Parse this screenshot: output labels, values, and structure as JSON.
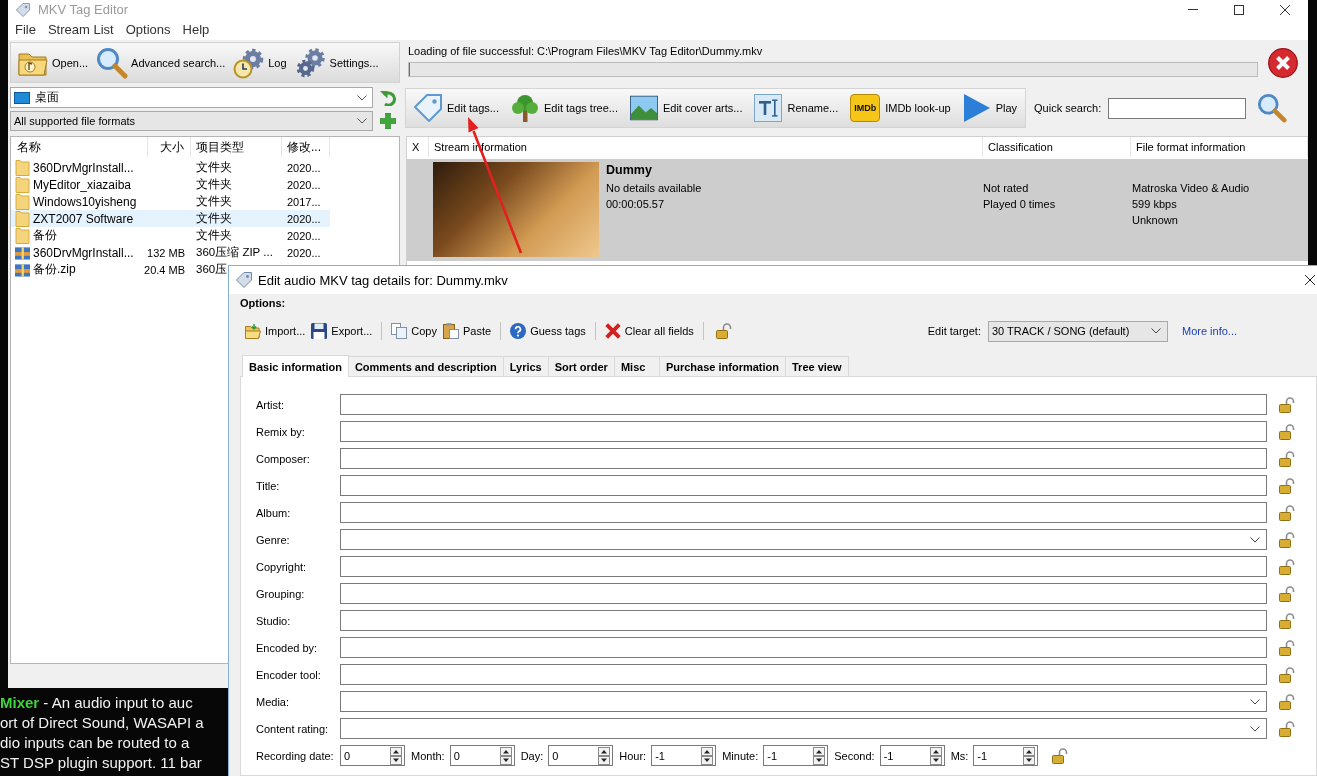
{
  "desktop": {
    "text_lines": [
      "**Mixer** - An audio input to auc",
      "ort of Direct Sound, WASAPI a",
      "dio inputs can be routed to a",
      "ST DSP plugin support. 11 bar"
    ]
  },
  "window": {
    "title": "MKV Tag Editor"
  },
  "menu": [
    "File",
    "Stream List",
    "Options",
    "Help"
  ],
  "browser": {
    "toolbar": [
      {
        "kind": "open",
        "label": "Open..."
      },
      {
        "kind": "search",
        "label": "Advanced search..."
      },
      {
        "kind": "log",
        "label": "Log"
      },
      {
        "kind": "settings",
        "label": "Settings..."
      }
    ],
    "location": "桌面",
    "filter": "All supported file formats",
    "columns": [
      "名称",
      "大小",
      "项目类型",
      "修改..."
    ],
    "rows": [
      {
        "kind": "folder",
        "name": "360DrvMgrInstall...",
        "type": "文件夹",
        "modified": "2020...",
        "selected": false
      },
      {
        "kind": "folder",
        "name": "MyEditor_xiazaiba",
        "type": "文件夹",
        "modified": "2020...",
        "selected": false
      },
      {
        "kind": "folder",
        "name": "Windows10yisheng",
        "type": "文件夹",
        "modified": "2017...",
        "selected": false
      },
      {
        "kind": "folder",
        "name": "ZXT2007 Software",
        "type": "文件夹",
        "modified": "2020...",
        "selected": true
      },
      {
        "kind": "folder",
        "name": "备份",
        "type": "文件夹",
        "modified": "2020...",
        "selected": false
      },
      {
        "kind": "archive",
        "name": "360DrvMgrInstall...",
        "size": "132 MB",
        "type": "360压缩 ZIP ...",
        "modified": "2020...",
        "selected": false
      },
      {
        "kind": "archive",
        "name": "备份.zip",
        "size": "20.4 MB",
        "type": "360压",
        "selected": false
      }
    ]
  },
  "status": {
    "message": "Loading of file successful: C:\\Program Files\\MKV Tag Editor\\Dummy.mkv",
    "progress": {
      "level": 0
    }
  },
  "stream_toolbar": {
    "buttons": [
      {
        "kind": "tag",
        "label": "Edit tags..."
      },
      {
        "kind": "tree",
        "label": "Edit tags tree..."
      },
      {
        "kind": "cover",
        "label": "Edit cover arts..."
      },
      {
        "kind": "rename",
        "label": "Rename..."
      },
      {
        "kind": "imdb",
        "logo": "IMDb",
        "label": "IMDb look-up"
      },
      {
        "kind": "play",
        "label": "Play"
      }
    ],
    "quick_search_label": "Quick search:"
  },
  "stream_table": {
    "columns": [
      "X",
      "Stream information",
      "Classification",
      "File format information"
    ],
    "rows": [
      {
        "selected": true,
        "title": "Dummy",
        "details": [
          "No details available",
          "00:00:05.57"
        ],
        "classification": [
          "Not rated",
          "Played 0 times"
        ],
        "format": [
          "Matroska Video & Audio",
          "599 kbps",
          "Unknown"
        ]
      }
    ]
  },
  "dialog": {
    "title": "Edit audio MKV tag details for: Dummy.mkv",
    "options_label": "Options:",
    "toolbar": [
      {
        "kind": "import",
        "label": "Import..."
      },
      {
        "kind": "export",
        "label": "Export..."
      },
      {
        "kind": "separator"
      },
      {
        "kind": "copy",
        "label": "Copy"
      },
      {
        "kind": "paste",
        "label": "Paste"
      },
      {
        "kind": "separator"
      },
      {
        "kind": "guess",
        "label": "Guess tags"
      },
      {
        "kind": "separator"
      },
      {
        "kind": "clear",
        "label": "Clear all fields"
      },
      {
        "kind": "separator"
      },
      {
        "kind": "lock",
        "locked": false
      }
    ],
    "edit_target": {
      "label": "Edit target:",
      "value": "30 TRACK / SONG (default)"
    },
    "more_info": "More info...",
    "tabs": [
      {
        "label": "Basic information",
        "selected": true
      },
      {
        "label": "Comments and description",
        "selected": false
      },
      {
        "label": "Lyrics",
        "selected": false
      },
      {
        "label": "Sort order",
        "selected": false
      },
      {
        "label": "Misc",
        "selected": false
      },
      {
        "label": "Purchase information",
        "selected": false
      },
      {
        "label": "Tree view",
        "selected": false
      }
    ],
    "fields": [
      {
        "kind": "text",
        "label": "Artist:",
        "locked": false
      },
      {
        "kind": "text",
        "label": "Remix by:",
        "locked": false
      },
      {
        "kind": "text",
        "label": "Composer:",
        "locked": false
      },
      {
        "kind": "text",
        "label": "Title:",
        "locked": false
      },
      {
        "kind": "text",
        "label": "Album:",
        "locked": false
      },
      {
        "kind": "dropdown",
        "label": "Genre:",
        "locked": false
      },
      {
        "kind": "text",
        "label": "Copyright:",
        "locked": false
      },
      {
        "kind": "text",
        "label": "Grouping:",
        "locked": false
      },
      {
        "kind": "text",
        "label": "Studio:",
        "locked": false
      },
      {
        "kind": "text",
        "label": "Encoded by:",
        "locked": false
      },
      {
        "kind": "text",
        "label": "Encoder tool:",
        "locked": false
      },
      {
        "kind": "dropdown",
        "label": "Media:",
        "locked": false
      },
      {
        "kind": "dropdown",
        "label": "Content rating:",
        "locked": false
      }
    ],
    "date_row": {
      "label": "Recording date:",
      "locked": false,
      "spinners": [
        {
          "value": "0"
        },
        {
          "label": "Month:",
          "value": "0"
        },
        {
          "label": "Day:",
          "value": "0"
        },
        {
          "label": "Hour:",
          "value": "-1"
        },
        {
          "label": "Minute:",
          "value": "-1"
        },
        {
          "label": "Second:",
          "value": "-1"
        },
        {
          "label": "Ms:",
          "value": "-1"
        }
      ]
    }
  }
}
